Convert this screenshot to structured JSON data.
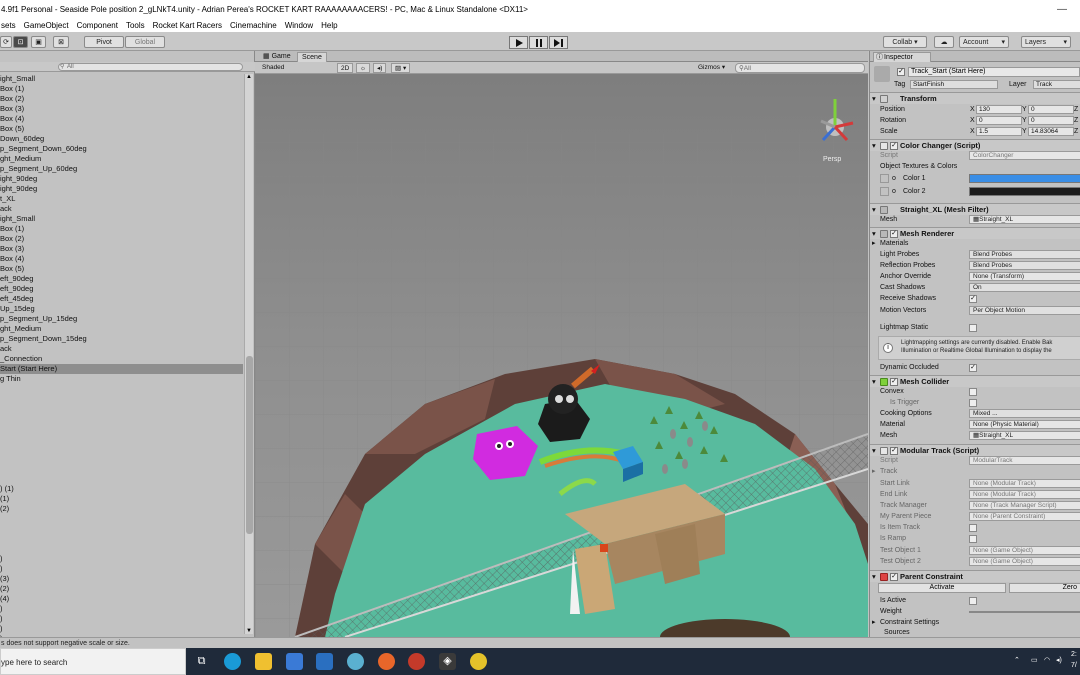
{
  "window": {
    "title": "4.9f1 Personal - Seaside Pole position 2_gLNkT4.unity - Adrian Perea's ROCKET KART RAAAAAAAACERS! - PC, Mac & Linux Standalone <DX11>",
    "min": "—",
    "max": "☐"
  },
  "menu": [
    "sets",
    "GameObject",
    "Component",
    "Tools",
    "Rocket Kart Racers",
    "Cinemachine",
    "Window",
    "Help"
  ],
  "toolbar": {
    "pivot": "Pivot",
    "global": "Global",
    "collab": "Collab ▾",
    "account": "Account",
    "layers": "Layers"
  },
  "hierarchy": {
    "search_placeholder": "All",
    "selected_index": 29,
    "items": [
      "ight_Small",
      " Box (1)",
      " Box (2)",
      " Box (3)",
      " Box (4)",
      " Box (5)",
      "Down_60deg",
      "p_Segment_Down_60deg",
      "ght_Medium",
      "p_Segment_Up_60deg",
      "ight_90deg",
      "ight_90deg",
      "t_XL",
      "ack",
      "ight_Small",
      " Box (1)",
      " Box (2)",
      " Box (3)",
      " Box (4)",
      " Box (5)",
      "eft_90deg",
      "eft_90deg",
      "eft_45deg",
      "Up_15deg",
      "p_Segment_Up_15deg",
      "ght_Medium",
      "p_Segment_Down_15deg",
      "ack",
      "_Connection",
      "Start (Start Here)",
      "g Thin",
      "",
      "",
      "",
      "",
      "",
      "",
      "",
      "",
      "",
      "",
      ") (1)",
      " (1)",
      " (2)",
      "",
      "",
      "",
      "",
      ")",
      ")",
      " (3)",
      " (2)",
      " (4)",
      ")",
      ")",
      ")",
      ")",
      ")",
      " (5)"
    ]
  },
  "scene": {
    "tab_game": "Game",
    "tab_scene": "Scene",
    "shading": "Shaded",
    "mode2d": "2D",
    "gizmos": "Gizmos",
    "search_placeholder": "All",
    "persp": "Persp"
  },
  "inspector": {
    "tab": "Inspector",
    "object_name": "Track_Start (Start Here)",
    "tag_label": "Tag",
    "tag": "StartFinish",
    "layer_label": "Layer",
    "layer": "Track",
    "transform": {
      "title": "Transform",
      "position_label": "Position",
      "rotation_label": "Rotation",
      "scale_label": "Scale",
      "position": {
        "x": "130",
        "y": "0"
      },
      "rotation": {
        "x": "0",
        "y": "0"
      },
      "scale": {
        "x": "1.5",
        "y": "14.83064"
      }
    },
    "color_changer": {
      "title": "Color Changer (Script)",
      "script_label": "Script",
      "script": "ColorChanger",
      "textures_label": "Object Textures & Colors",
      "color1_label": "Color 1",
      "color2_label": "Color 2",
      "color1": "#3a8ee6",
      "color2": "#1c1c1c"
    },
    "mesh_filter": {
      "title": "Straight_XL (Mesh Filter)",
      "mesh_label": "Mesh",
      "mesh": "Straight_XL"
    },
    "mesh_renderer": {
      "title": "Mesh Renderer",
      "materials": "Materials",
      "light_probes_label": "Light Probes",
      "light_probes": "Blend Probes",
      "reflection_probes_label": "Reflection Probes",
      "reflection_probes": "Blend Probes",
      "anchor_label": "Anchor Override",
      "anchor": "None (Transform)",
      "cast_shadows_label": "Cast Shadows",
      "cast_shadows": "On",
      "receive_shadows_label": "Receive Shadows",
      "motion_vectors_label": "Motion Vectors",
      "motion_vectors": "Per Object Motion",
      "lightmap_static_label": "Lightmap Static",
      "info": "Lightmapping settings are currently disabled. Enable Bak Illumination or Realtime Global Illumination to display the",
      "dynamic_occluded_label": "Dynamic Occluded"
    },
    "mesh_collider": {
      "title": "Mesh Collider",
      "convex_label": "Convex",
      "is_trigger_label": "Is Trigger",
      "cooking_label": "Cooking Options",
      "cooking": "Mixed ...",
      "material_label": "Material",
      "material": "None (Physic Material)",
      "mesh_label": "Mesh",
      "mesh": "Straight_XL"
    },
    "modular_track": {
      "title": "Modular Track (Script)",
      "script_label": "Script",
      "script": "ModularTrack",
      "track_label": "Track",
      "start_link_label": "Start Link",
      "start_link": "None (Modular Track)",
      "end_link_label": "End Link",
      "end_link": "None (Modular Track)",
      "track_manager_label": "Track Manager",
      "track_manager": "None (Track Manager Script)",
      "parent_piece_label": "My Parent Piece",
      "parent_piece": "None (Parent Constraint)",
      "is_item_label": "Is Item Track",
      "is_ramp_label": "Is Ramp",
      "test1_label": "Test Object 1",
      "test1": "None (Game Object)",
      "test2_label": "Test Object 2",
      "test2": "None (Game Object)"
    },
    "parent_constraint": {
      "title": "Parent Constraint",
      "activate": "Activate",
      "zero": "Zero",
      "is_active_label": "Is Active",
      "weight_label": "Weight",
      "settings_label": "Constraint Settings",
      "sources_label": "Sources"
    }
  },
  "status": "s does not support negative scale or size.",
  "taskbar": {
    "search": "ype here to search",
    "clock": "2:",
    "date": "7/"
  }
}
